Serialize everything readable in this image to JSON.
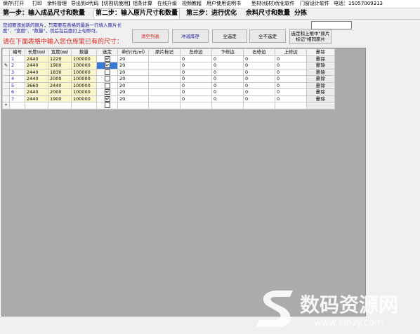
{
  "menu": [
    "保存\\打开",
    "打印",
    "余料管理",
    "导出到d代码【切割机使用】",
    "铝条计算",
    "在线升级",
    "视频教程",
    "用户使用说明书",
    "型材(线材)优化软件",
    "门窗设计软件",
    "电话：15057009313"
  ],
  "tabs": [
    "第一步：输入成品尺寸和数量",
    "第二步：输入原片尺寸和数量",
    "第三步：进行优化",
    "余料尺寸和数量",
    "分拣"
  ],
  "hint": "您如要添加新的原片，只需要在表格的最后一行填入原片长度\"、\"宽度\"、\"数量\"，然后在后面打上勾即可。",
  "warning": "请在下面表格中输入您仓库里已有的尺寸：",
  "buttons": {
    "clear": "清空列表",
    "reduce": "冲减库存",
    "select_all": "全选定",
    "deselect_all": "全不选定",
    "select_marked": "选定和上框中\"原片标记\"相同原片"
  },
  "columns": [
    "编号",
    "长度(㎜)",
    "宽度(㎜)",
    "数量",
    "选定",
    "单价(元/㎡)",
    "原片标记",
    "左修边",
    "下修边",
    "右修边",
    "上修边",
    "删除"
  ],
  "rows": [
    {
      "no": "1",
      "len": "2440",
      "wid": "1220",
      "qty": "100000",
      "checked": true,
      "price": "20",
      "mark": "",
      "l": "0",
      "b": "0",
      "r": "0",
      "t": "0",
      "del": "删除",
      "marker": ""
    },
    {
      "no": "2",
      "len": "2440",
      "wid": "1900",
      "qty": "100000",
      "checked": true,
      "price": "20",
      "mark": "",
      "l": "0",
      "b": "0",
      "r": "0",
      "t": "0",
      "del": "删除",
      "marker": "✎"
    },
    {
      "no": "3",
      "len": "2440",
      "wid": "1830",
      "qty": "100000",
      "checked": false,
      "price": "20",
      "mark": "",
      "l": "0",
      "b": "0",
      "r": "0",
      "t": "0",
      "del": "删除",
      "marker": ""
    },
    {
      "no": "4",
      "len": "2440",
      "wid": "2000",
      "qty": "100000",
      "checked": false,
      "price": "20",
      "mark": "",
      "l": "0",
      "b": "0",
      "r": "0",
      "t": "0",
      "del": "删除",
      "marker": ""
    },
    {
      "no": "5",
      "len": "3660",
      "wid": "2440",
      "qty": "100000",
      "checked": false,
      "price": "20",
      "mark": "",
      "l": "0",
      "b": "0",
      "r": "0",
      "t": "0",
      "del": "删除",
      "marker": ""
    },
    {
      "no": "6",
      "len": "2440",
      "wid": "2000",
      "qty": "100000",
      "checked": true,
      "price": "20",
      "mark": "",
      "l": "0",
      "b": "0",
      "r": "0",
      "t": "0",
      "del": "删除",
      "marker": ""
    },
    {
      "no": "7",
      "len": "2440",
      "wid": "1900",
      "qty": "100000",
      "checked": true,
      "price": "20",
      "mark": "",
      "l": "0",
      "b": "0",
      "r": "0",
      "t": "0",
      "del": "删除",
      "marker": ""
    }
  ],
  "new_row_marker": "*",
  "watermark": {
    "text": "数码资源网",
    "url": "www.smzy.com"
  }
}
